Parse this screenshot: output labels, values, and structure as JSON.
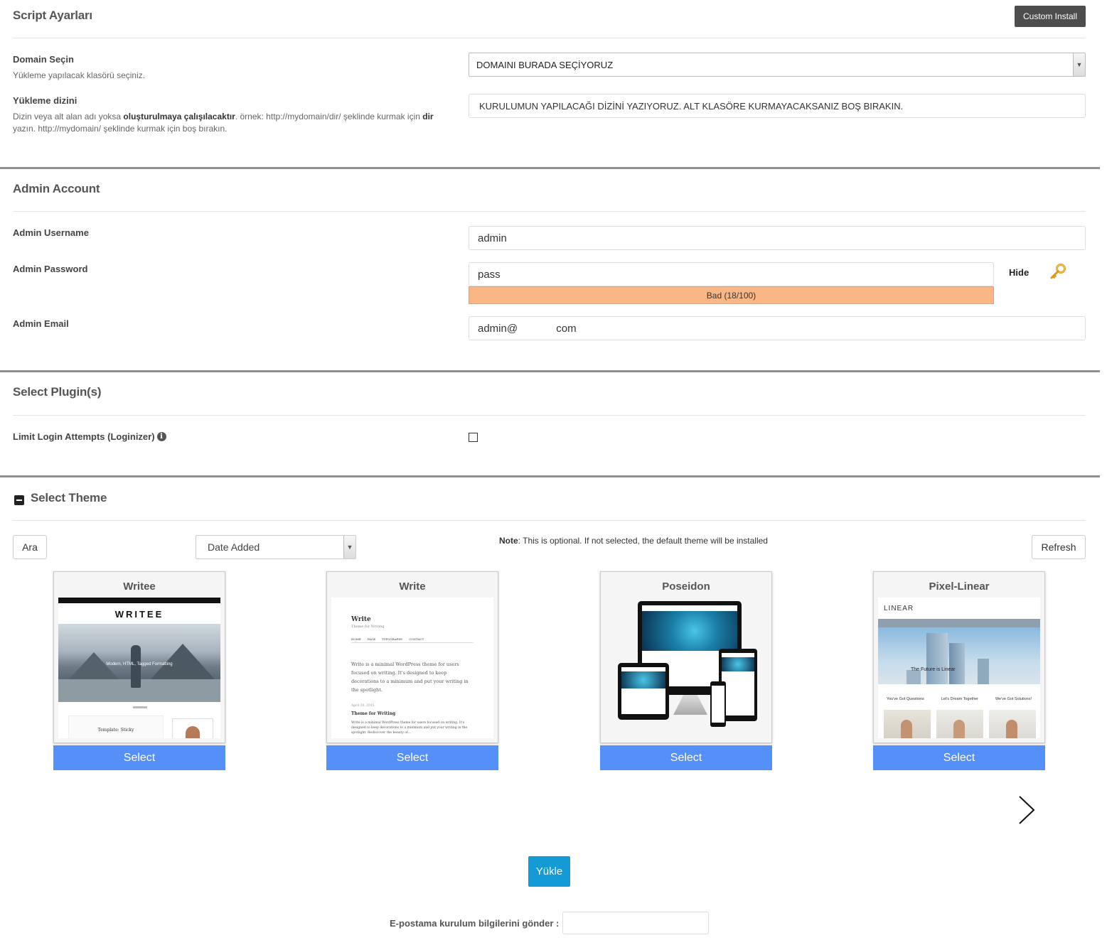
{
  "script_settings": {
    "title": "Script Ayarları",
    "custom_install_label": "Custom Install",
    "domain_label": "Domain Seçin",
    "domain_hint": "Yükleme yapılacak klasörü seçiniz.",
    "domain_value": "DOMAINI BURADA SEÇİYORUZ",
    "dir_label": "Yükleme dizini",
    "dir_hint_1": "Dizin veya alt alan adı yoksa ",
    "dir_hint_bold_1": "oluşturulmaya çalışılacaktır",
    "dir_hint_2": ". örnek: http://mydomain/dir/ şeklinde kurmak için ",
    "dir_hint_bold_2": "dir",
    "dir_hint_3": " yazın. http://mydomain/ şeklinde kurmak için boş bırakın.",
    "dir_value": "KURULUMUN YAPILACAĞI DİZİNİ YAZIYORUZ. ALT KLASÖRE KURMAYACAKSANIZ BOŞ BIRAKIN."
  },
  "admin_account": {
    "title": "Admin Account",
    "username_label": "Admin Username",
    "username_value": "admin",
    "password_label": "Admin Password",
    "password_value": "pass",
    "hide_label": "Hide",
    "strength_text": "Bad (18/100)",
    "strength_percent": 18,
    "email_label": "Admin Email",
    "email_value": "admin@             com"
  },
  "plugins": {
    "title": "Select Plugin(s)",
    "loginizer_label": "Limit Login Attempts (Loginizer)",
    "loginizer_checked": false
  },
  "theme": {
    "title": "Select Theme",
    "search_label": "Ara",
    "sort_value": "Date Added",
    "note_bold": "Note",
    "note_text": ": This is optional. If not selected, the default theme will be installed",
    "refresh_label": "Refresh",
    "select_label": "Select",
    "cards": [
      {
        "name": "Writee"
      },
      {
        "name": "Write"
      },
      {
        "name": "Poseidon"
      },
      {
        "name": "Pixel-Linear"
      }
    ],
    "preview": {
      "writee_logo": "WRITEE",
      "writee_caption": "Modern, HTML, Tagged Formatting",
      "writee_post": "Template: Sticky",
      "write_title": "Write",
      "write_sub": "Theme for Writing",
      "write_nav": [
        "HOME",
        "PAGE",
        "TYPOGRAPHY",
        "CONTACT"
      ],
      "write_body": "Write is a minimal WordPress theme for users focused on writing. It's designed to keep decorations to a minimum and put your writing in the spotlight.",
      "write_date": "April 20, 2015",
      "write_post_title": "Theme for Writing",
      "write_post_body": "Write is a minimal WordPress theme for users focused on writing. It's designed to keep decorations to a minimum and put your writing in the spotlight. Rediscover the beauty of...",
      "linear_logo": "LINEAR",
      "linear_hero": "The Future is Linear",
      "linear_cols": [
        "You've Got Questions",
        "Let's Dream Together",
        "We've Got Solutions!"
      ]
    }
  },
  "install": {
    "button_label": "Yükle",
    "email_label": "E-postama kurulum bilgilerini gönder :",
    "email_value": ""
  },
  "colors": {
    "accent_select": "#5590f8",
    "install_button": "#149ad4",
    "strength_bad": "#fbb686"
  }
}
